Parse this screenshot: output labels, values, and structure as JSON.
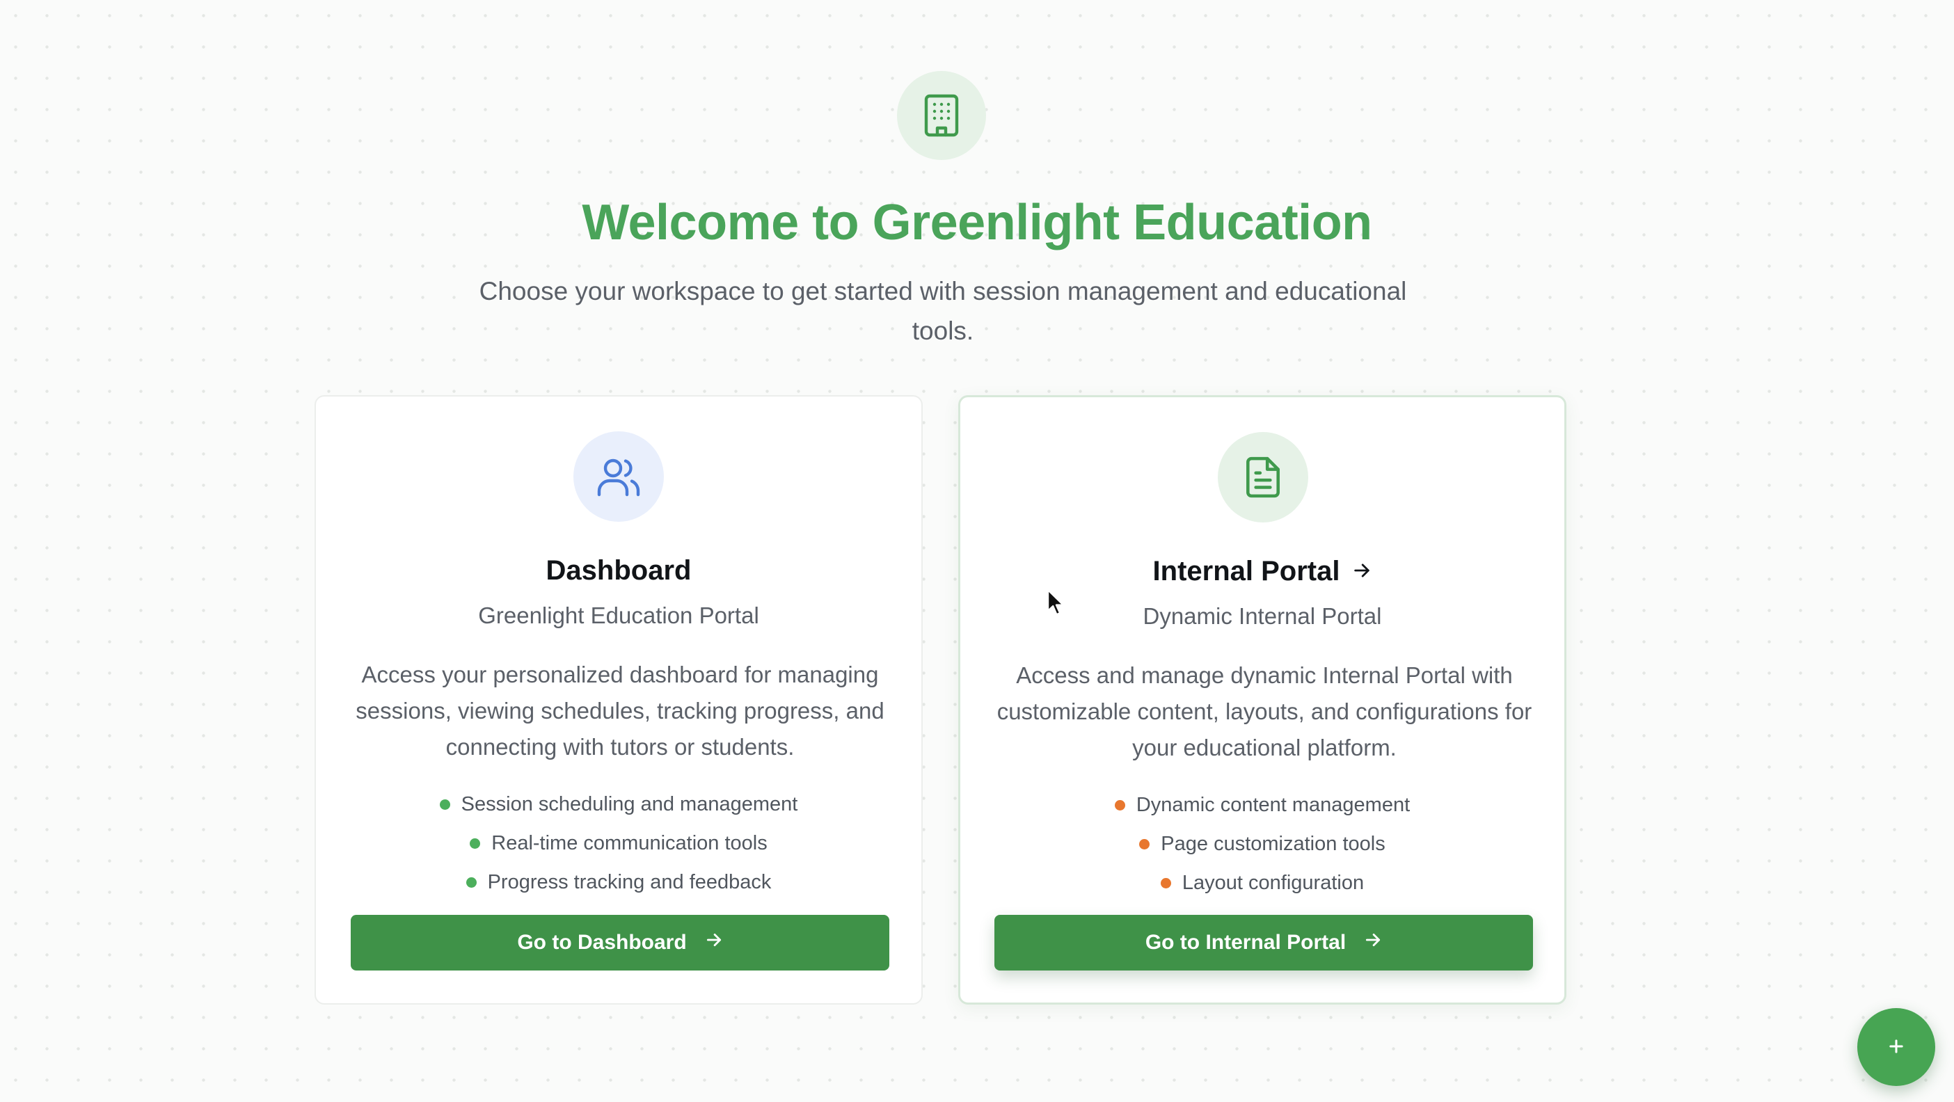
{
  "hero": {
    "icon": "building-icon",
    "title": "Welcome to Greenlight Education",
    "subtitle": "Choose your workspace to get started with session management and educational tools."
  },
  "cards": [
    {
      "icon": "users-icon",
      "title": "Dashboard",
      "subtitle": "Greenlight Education Portal",
      "description": "Access your personalized dashboard for managing sessions, viewing schedules, tracking progress, and connecting with tutors or students.",
      "features": [
        "Session scheduling and management",
        "Real-time communication tools",
        "Progress tracking and feedback"
      ],
      "bullet_color": "#4caf5c",
      "button_label": "Go to Dashboard"
    },
    {
      "icon": "document-icon",
      "title": "Internal Portal",
      "subtitle": "Dynamic Internal Portal",
      "description": "Access and manage dynamic Internal Portal with customizable content, layouts, and configurations for your educational platform.",
      "features": [
        "Dynamic content management",
        "Page customization tools",
        "Layout configuration"
      ],
      "bullet_color": "#e8772e",
      "button_label": "Go to Internal Portal"
    }
  ],
  "fab": {
    "icon": "plus-icon"
  },
  "colors": {
    "brand_green": "#4aa45a",
    "button_green": "#3f9248",
    "accent_orange": "#e8772e",
    "icon_blue": "#4a7bd8"
  }
}
